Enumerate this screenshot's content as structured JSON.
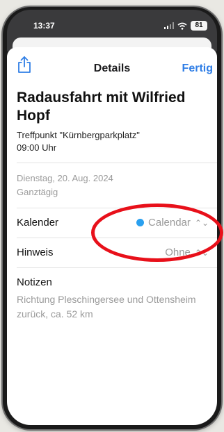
{
  "status_bar": {
    "time": "13:37",
    "battery": "81"
  },
  "nav": {
    "title": "Details",
    "done": "Fertig"
  },
  "event": {
    "title": "Radausfahrt mit Wilfried Hopf",
    "location": "Treffpunkt \"Kürnbergparkplatz\"",
    "start_time": "09:00 Uhr",
    "date": "Dienstag, 20. Aug. 2024",
    "all_day": "Ganztägig"
  },
  "calendar_row": {
    "label": "Kalender",
    "value": "Calendar",
    "dot_color": "#2aa0ef"
  },
  "alert_row": {
    "label": "Hinweis",
    "value": "Ohne"
  },
  "notes": {
    "label": "Notizen",
    "text": "Richtung Pleschingersee und Ottensheim zurück, ca. 52 km"
  },
  "colors": {
    "accent": "#2f7ee6",
    "highlight": "#e8101a"
  },
  "icons": {
    "share": "share-icon",
    "chevron": "chevron-up-down-icon"
  }
}
